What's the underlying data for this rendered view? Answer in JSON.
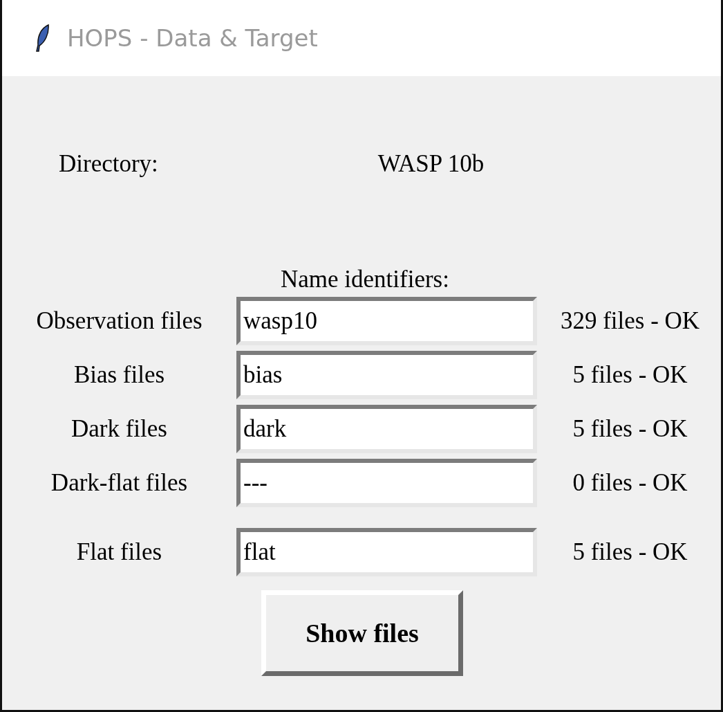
{
  "window": {
    "title": "HOPS - Data & Target"
  },
  "directory": {
    "label": "Directory:",
    "value": "WASP 10b"
  },
  "name_identifiers_label": "Name identifiers:",
  "rows": [
    {
      "label": "Observation files",
      "value": "wasp10",
      "status": "329 files - OK"
    },
    {
      "label": "Bias files",
      "value": "bias",
      "status": "5 files - OK"
    },
    {
      "label": "Dark files",
      "value": "dark",
      "status": "5 files - OK"
    },
    {
      "label": "Dark-flat files",
      "value": "---",
      "status": "0 files - OK"
    },
    {
      "label": "Flat files",
      "value": "flat",
      "status": "5 files - OK"
    }
  ],
  "button": {
    "label": "Show files"
  }
}
